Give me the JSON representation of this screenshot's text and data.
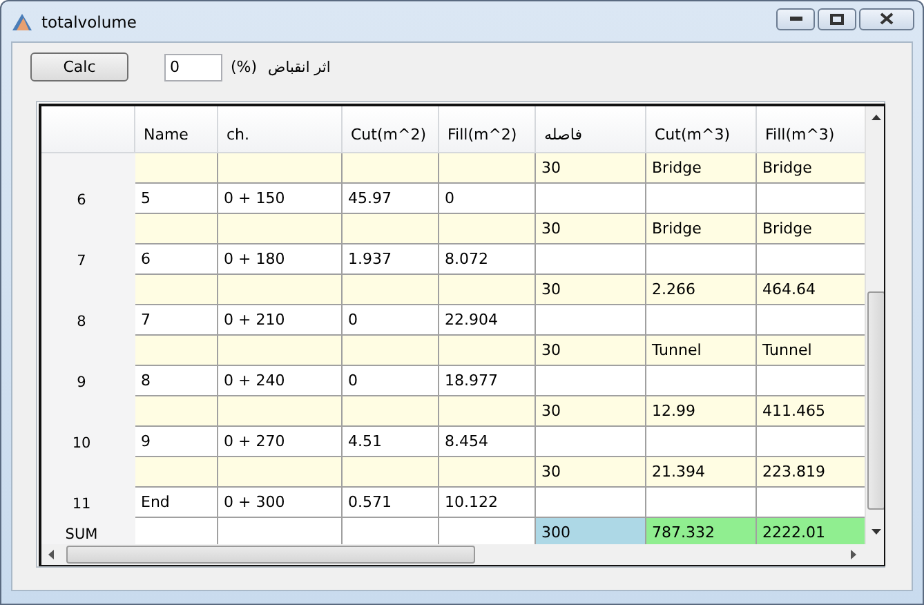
{
  "window": {
    "title": "totalvolume"
  },
  "toolbar": {
    "button": "Calc",
    "shrinkage_value": "0",
    "unit": "(%)",
    "shrinkage_label": "اثر انقباض"
  },
  "table": {
    "columns": [
      "Name",
      "ch.",
      "Cut(m^2)",
      "Fill(m^2)",
      "فاصله",
      "Cut(m^3)",
      "Fill(m^3)"
    ],
    "rows": [
      {
        "kind": "interval",
        "distance": "30",
        "cut": "Bridge",
        "fill": "Bridge"
      },
      {
        "kind": "station",
        "number": "6",
        "name": "5",
        "chainage": "0 + 150",
        "cut_area": "45.97",
        "fill_area": "0"
      },
      {
        "kind": "interval",
        "distance": "30",
        "cut": "Bridge",
        "fill": "Bridge"
      },
      {
        "kind": "station",
        "number": "7",
        "name": "6",
        "chainage": "0 + 180",
        "cut_area": "1.937",
        "fill_area": "8.072"
      },
      {
        "kind": "interval",
        "distance": "30",
        "cut": "2.266",
        "fill": "464.64"
      },
      {
        "kind": "station",
        "number": "8",
        "name": "7",
        "chainage": "0 + 210",
        "cut_area": "0",
        "fill_area": "22.904"
      },
      {
        "kind": "interval",
        "distance": "30",
        "cut": "Tunnel",
        "fill": "Tunnel"
      },
      {
        "kind": "station",
        "number": "9",
        "name": "8",
        "chainage": "0 + 240",
        "cut_area": "0",
        "fill_area": "18.977"
      },
      {
        "kind": "interval",
        "distance": "30",
        "cut": "12.99",
        "fill": "411.465"
      },
      {
        "kind": "station",
        "number": "10",
        "name": "9",
        "chainage": "0 + 270",
        "cut_area": "4.51",
        "fill_area": "8.454"
      },
      {
        "kind": "interval",
        "distance": "30",
        "cut": "21.394",
        "fill": "223.819"
      },
      {
        "kind": "station",
        "number": "11",
        "name": "End",
        "chainage": "0 + 300",
        "cut_area": "0.571",
        "fill_area": "10.122"
      },
      {
        "kind": "sum",
        "label": "SUM",
        "distance": "300",
        "cut": "787.332",
        "fill": "2222.01"
      }
    ]
  }
}
